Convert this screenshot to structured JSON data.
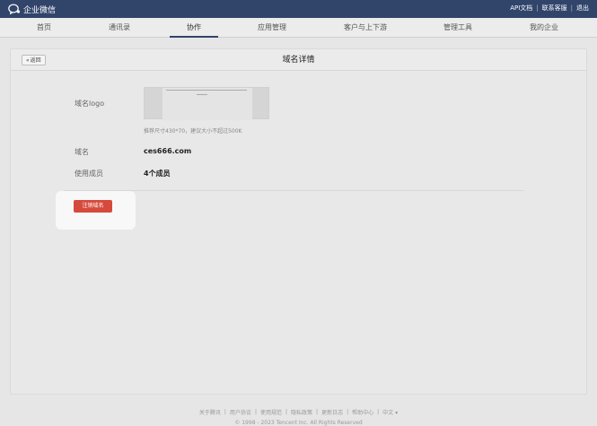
{
  "header": {
    "logo_text": "企业微信",
    "links": [
      "API文档",
      "联系客服",
      "退出"
    ]
  },
  "nav": {
    "items": [
      "首页",
      "通讯录",
      "协作",
      "应用管理",
      "客户与上下游",
      "管理工具",
      "我的企业"
    ],
    "active_index": 2
  },
  "page": {
    "back_label": "返回",
    "title": "域名详情",
    "logo_label": "域名logo",
    "logo_hint": "推荐尺寸430*70，建议大小不超过500K",
    "domain_label": "域名",
    "domain_value": "ces666.com",
    "members_label": "使用成员",
    "members_value": "4个成员",
    "deregister_label": "注销域名"
  },
  "footer": {
    "links": [
      "关于腾讯",
      "用户协议",
      "使用规范",
      "隐私政策",
      "更新日志",
      "帮助中心",
      "中文"
    ],
    "copyright": "© 1998 - 2023 Tencent Inc. All Rights Reserved"
  },
  "colors": {
    "topbar": "#31456b",
    "danger": "#d64a3c"
  }
}
